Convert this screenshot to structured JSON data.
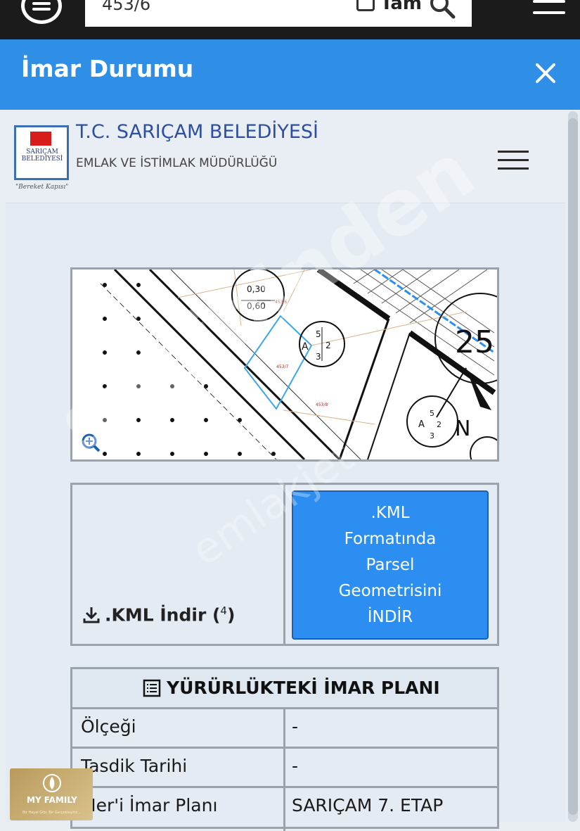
{
  "topbar": {
    "search_value": "453/6",
    "tam_label": "Tam"
  },
  "modal": {
    "title": "İmar Durumu"
  },
  "header": {
    "org_name": "T.C. SARIÇAM BELEDİYESİ",
    "org_sub": "EMLAK VE İSTİMLAK MÜDÜRLÜĞÜ",
    "logo_text": "SARIÇAM BELEDİYESİ",
    "logo_slogan": "\"Bereket Kapısı\""
  },
  "map": {
    "labels": {
      "circle_top_1": "0,30",
      "circle_top_2": "0,60",
      "circle_mid_a": "A",
      "circle_mid_5": "5",
      "circle_mid_2": "2",
      "circle_mid_3": "3",
      "big_number": "25",
      "north": "N",
      "circle_bot_a": "A",
      "circle_bot_5": "5",
      "circle_bot_2": "2",
      "circle_bot_3": "3",
      "parcel_1": "453/6",
      "parcel_2": "453/7",
      "parcel_3": "453/8"
    }
  },
  "kml": {
    "download_label": ".KML İndir (",
    "download_count": "4",
    "download_close": ")",
    "button_lines": [
      ".KML",
      "Formatında",
      "Parsel",
      "Geometrisini",
      "İNDİR"
    ]
  },
  "plan_table": {
    "title": "YÜRÜRLÜKTEKİ İMAR PLANI",
    "rows": [
      {
        "label": "Ölçeği",
        "value": "-"
      },
      {
        "label": "Tasdik Tarihi",
        "value": "-"
      },
      {
        "label": "Mer'i İmar Planı",
        "value": "SARIÇAM 7. ETAP"
      }
    ]
  },
  "watermarks": {
    "main": "sahibinden",
    "secondary": "emlakjet"
  },
  "badge": {
    "title": "MY FAMILY",
    "sub": "Bir Hayal Gibi, Bir Gerçekleşiriz..."
  },
  "colors": {
    "modal_header": "#2f8ee6",
    "kml_button": "#2c8ef0",
    "org_name": "#2d4fa0"
  }
}
